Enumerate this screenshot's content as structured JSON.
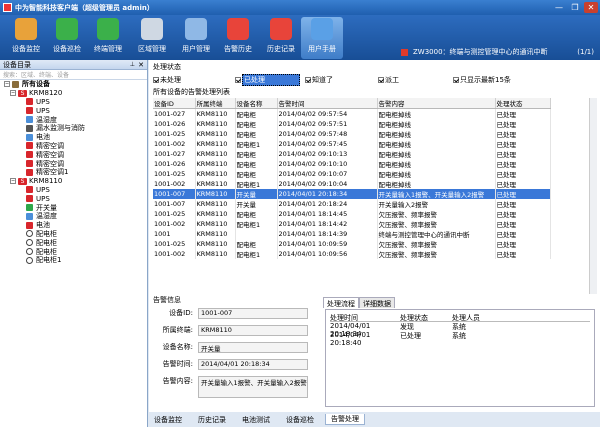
{
  "app": {
    "title": "中为智能科技客户端（超级管理员 admin）"
  },
  "toolbar": [
    {
      "label": "设备监控",
      "icon": "monitor-eye-icon",
      "color": "#e8a23a"
    },
    {
      "label": "设备巡检",
      "icon": "refresh-icon",
      "color": "#3bb04a"
    },
    {
      "label": "终端管理",
      "icon": "plus-icon",
      "color": "#3bb04a"
    },
    {
      "label": "区域管理",
      "icon": "house-icon",
      "color": "#cfd8e3"
    },
    {
      "label": "用户管理",
      "icon": "users-icon",
      "color": "#8fb8e6"
    },
    {
      "label": "告警历史",
      "icon": "database-icon",
      "color": "#e8443a"
    },
    {
      "label": "历史记录",
      "icon": "history-icon",
      "color": "#e8443a"
    },
    {
      "label": "用户手册",
      "icon": "manual-icon",
      "color": "#5aa0e6"
    }
  ],
  "notification": {
    "text": "ZW3000：终端与测控管理中心的通讯中断",
    "count": "(1/1)"
  },
  "left": {
    "title": "设备目录",
    "pin": "⊥",
    "close": "✕",
    "search_placeholder": "搜索：区域、终端、设备",
    "tree": [
      {
        "label": "所有设备",
        "level": 0,
        "type": "root"
      },
      {
        "label": "KRM8120",
        "level": 1,
        "type": "dev"
      },
      {
        "label": "UPS",
        "level": 2,
        "type": "red"
      },
      {
        "label": "UPS",
        "level": 2,
        "type": "red"
      },
      {
        "label": "温湿度",
        "level": 2,
        "type": "blue"
      },
      {
        "label": "漏水监测与消防",
        "level": 2,
        "type": "gray"
      },
      {
        "label": "电池",
        "level": 2,
        "type": "blue"
      },
      {
        "label": "精密空调",
        "level": 2,
        "type": "red"
      },
      {
        "label": "精密空调",
        "level": 2,
        "type": "red"
      },
      {
        "label": "精密空调",
        "level": 2,
        "type": "red"
      },
      {
        "label": "精密空调1",
        "level": 2,
        "type": "red"
      },
      {
        "label": "KRM8110",
        "level": 1,
        "type": "dev"
      },
      {
        "label": "UPS",
        "level": 2,
        "type": "red"
      },
      {
        "label": "UPS",
        "level": 2,
        "type": "red"
      },
      {
        "label": "开关量",
        "level": 2,
        "type": "green"
      },
      {
        "label": "温湿度",
        "level": 2,
        "type": "blue"
      },
      {
        "label": "电池",
        "level": 2,
        "type": "red"
      },
      {
        "label": "配电柜",
        "level": 2,
        "type": "pin"
      },
      {
        "label": "配电柜",
        "level": 2,
        "type": "pin"
      },
      {
        "label": "配电柜",
        "level": 2,
        "type": "pin"
      },
      {
        "label": "配电柜1",
        "level": 2,
        "type": "pin"
      }
    ]
  },
  "status_filter": {
    "title": "处理状态",
    "options": [
      {
        "label": "未处理",
        "checked": true
      },
      {
        "label": "已处理",
        "checked": true,
        "selected": true
      },
      {
        "label": "知道了",
        "checked": true
      },
      {
        "label": "派工",
        "checked": true
      },
      {
        "label": "只显示最新15条",
        "checked": true
      }
    ]
  },
  "alarm_list": {
    "title": "所有设备的告警处理列表",
    "columns": [
      "设备ID",
      "所属终端",
      "设备名称",
      "告警时间",
      "告警内容",
      "处理状态"
    ],
    "rows": [
      [
        "1001-027",
        "KRM8110",
        "配电柜",
        "2014/04/02 09:57:54",
        "配电柜掉线",
        "已处理"
      ],
      [
        "1001-026",
        "KRM8110",
        "配电柜",
        "2014/04/02 09:57:51",
        "配电柜掉线",
        "已处理"
      ],
      [
        "1001-025",
        "KRM8110",
        "配电柜",
        "2014/04/02 09:57:48",
        "配电柜掉线",
        "已处理"
      ],
      [
        "1001-002",
        "KRM8110",
        "配电柜1",
        "2014/04/02 09:57:45",
        "配电柜掉线",
        "已处理"
      ],
      [
        "1001-027",
        "KRM8110",
        "配电柜",
        "2014/04/02 09:10:13",
        "配电柜掉线",
        "已处理"
      ],
      [
        "1001-026",
        "KRM8110",
        "配电柜",
        "2014/04/02 09:10:10",
        "配电柜掉线",
        "已处理"
      ],
      [
        "1001-025",
        "KRM8110",
        "配电柜",
        "2014/04/02 09:10:07",
        "配电柜掉线",
        "已处理"
      ],
      [
        "1001-002",
        "KRM8110",
        "配电柜1",
        "2014/04/02 09:10:04",
        "配电柜掉线",
        "已处理"
      ],
      [
        "1001-007",
        "KRM8110",
        "开关量",
        "2014/04/01 20:18:34",
        "开关量输入1报警、开关量输入2报警",
        "已处理"
      ],
      [
        "1001-007",
        "KRM8110",
        "开关量",
        "2014/04/01 20:18:24",
        "开关量输入2报警",
        "已处理"
      ],
      [
        "1001-025",
        "KRM8110",
        "配电柜",
        "2014/04/01 18:14:45",
        "欠压报警、频率报警",
        "已处理"
      ],
      [
        "1001-002",
        "KRM8110",
        "配电柜1",
        "2014/04/01 18:14:42",
        "欠压报警、频率报警",
        "已处理"
      ],
      [
        "1001",
        "KRM8110",
        "",
        "2014/04/01 18:14:39",
        "终端与测控管理中心的通讯中断",
        "已处理"
      ],
      [
        "1001-025",
        "KRM8110",
        "配电柜",
        "2014/04/01 10:09:59",
        "欠压报警、频率报警",
        "已处理"
      ],
      [
        "1001-002",
        "KRM8110",
        "配电柜1",
        "2014/04/01 10:09:56",
        "欠压报警、频率报警",
        "已处理"
      ]
    ],
    "selected_index": 8
  },
  "detail": {
    "title": "告警信息",
    "fields": [
      {
        "label": "设备ID:",
        "value": "1001-007"
      },
      {
        "label": "所属终端:",
        "value": "KRM8110"
      },
      {
        "label": "设备名称:",
        "value": "开关量"
      },
      {
        "label": "告警时间:",
        "value": "2014/04/01 20:18:34"
      },
      {
        "label": "告警内容:",
        "value": "开关量输入1报警、开关量输入2报警"
      }
    ]
  },
  "process": {
    "tabs": [
      "处理流程",
      "详细数据"
    ],
    "columns": [
      "处理时间",
      "处理状态",
      "处理人员"
    ],
    "rows": [
      [
        "2014/04/01 20:18:34",
        "发现",
        "系统"
      ],
      [
        "2014/04/01 20:18:40",
        "已处理",
        "系统"
      ]
    ]
  },
  "bottom_tabs": [
    "设备监控",
    "历史记录",
    "电池测试",
    "设备巡检",
    "告警处理"
  ],
  "bottom_active": 4
}
